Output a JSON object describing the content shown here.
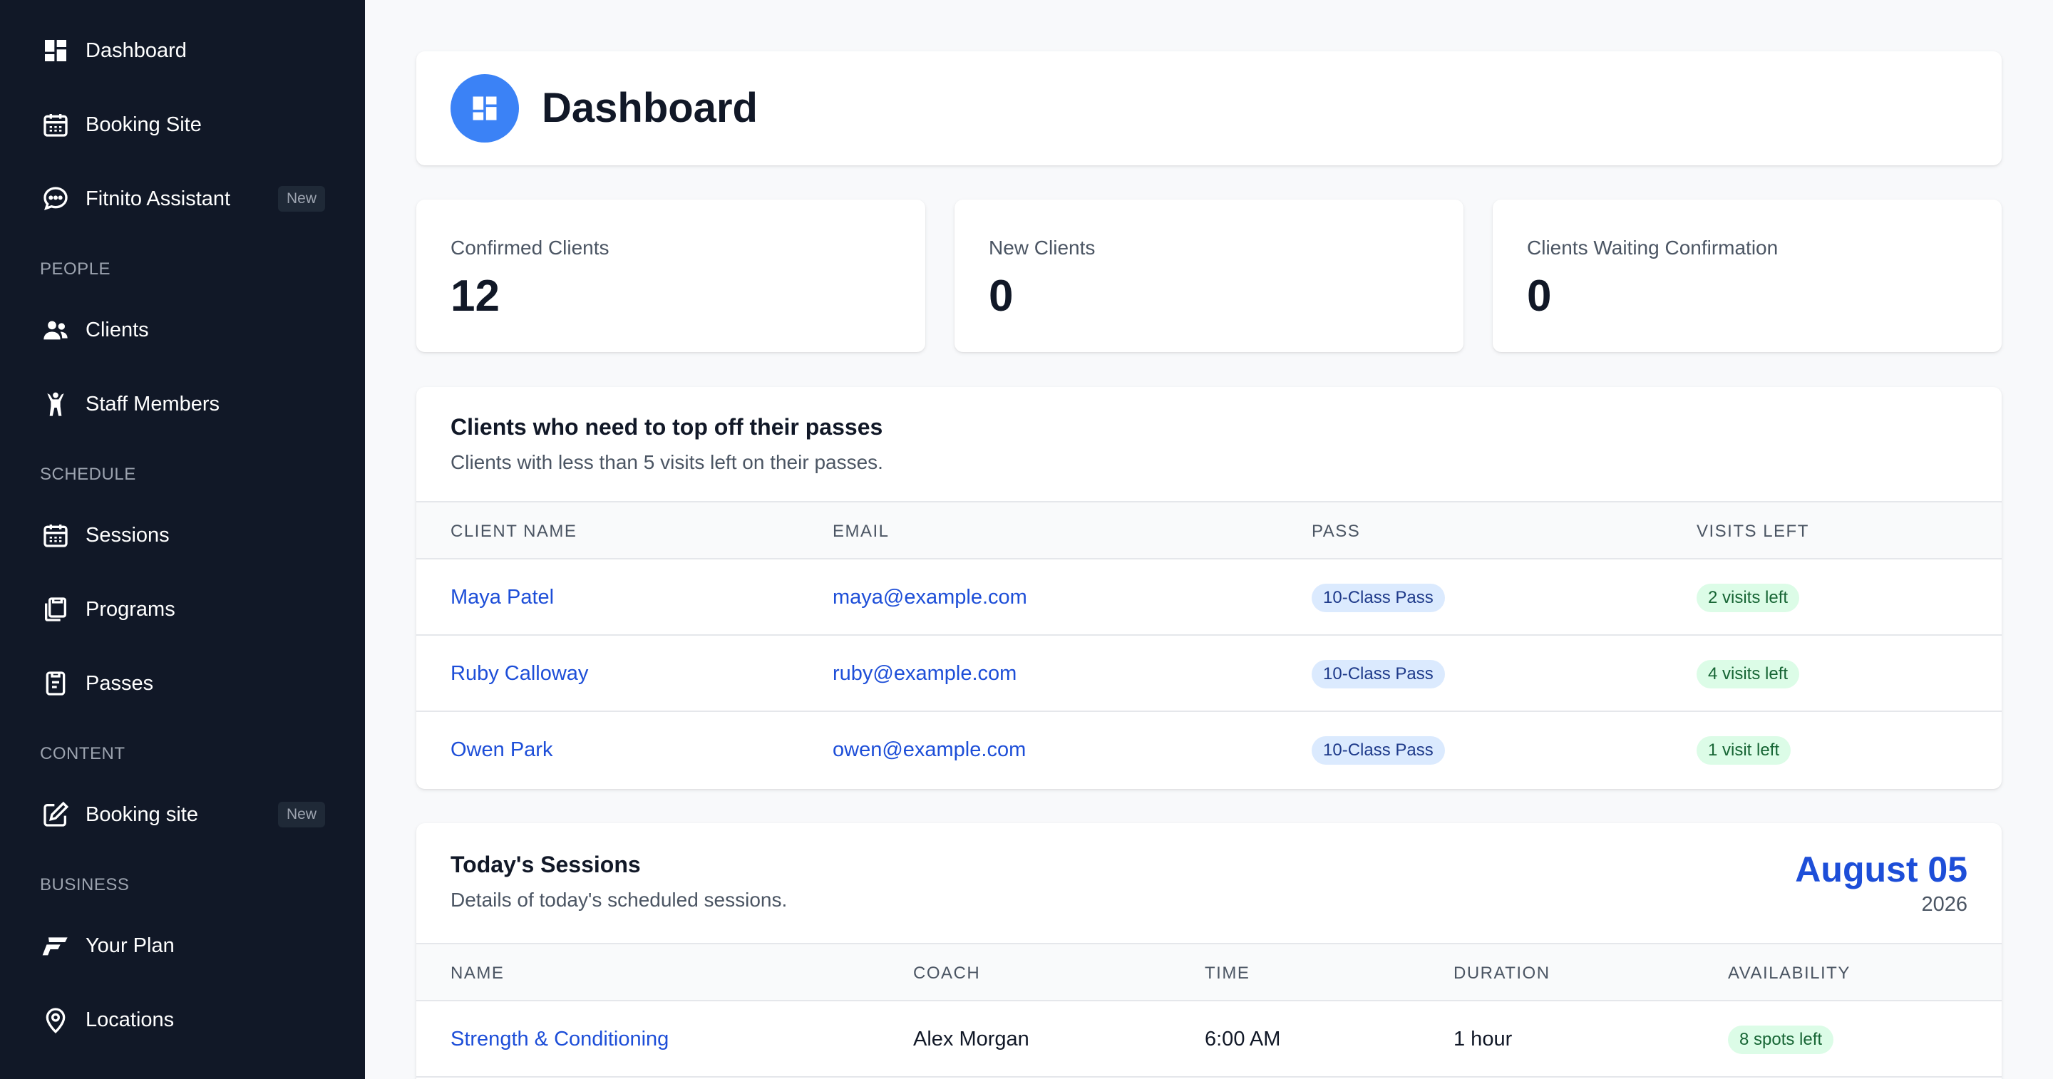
{
  "sidebar": {
    "items_top": [
      {
        "label": "Dashboard",
        "icon": "dashboard-icon"
      },
      {
        "label": "Booking Site",
        "icon": "calendar-icon"
      },
      {
        "label": "Fitnito Assistant",
        "icon": "chat-icon",
        "badge": "New"
      }
    ],
    "sections": {
      "people": "PEOPLE",
      "schedule": "SCHEDULE",
      "content": "CONTENT",
      "business": "BUSINESS"
    },
    "people_items": [
      {
        "label": "Clients",
        "icon": "users-icon"
      },
      {
        "label": "Staff Members",
        "icon": "person-icon"
      }
    ],
    "schedule_items": [
      {
        "label": "Sessions",
        "icon": "calendar-icon"
      },
      {
        "label": "Programs",
        "icon": "clipboard-icon"
      },
      {
        "label": "Passes",
        "icon": "pass-icon"
      }
    ],
    "content_items": [
      {
        "label": "Booking site",
        "icon": "edit-icon",
        "badge": "New"
      }
    ],
    "business_items": [
      {
        "label": "Your Plan",
        "icon": "plan-logo-icon"
      },
      {
        "label": "Locations",
        "icon": "map-pin-icon"
      }
    ]
  },
  "header": {
    "title": "Dashboard"
  },
  "stats": [
    {
      "label": "Confirmed Clients",
      "value": "12"
    },
    {
      "label": "New Clients",
      "value": "0"
    },
    {
      "label": "Clients Waiting Confirmation",
      "value": "0"
    }
  ],
  "topoff": {
    "title": "Clients who need to top off their passes",
    "subtitle": "Clients with less than 5 visits left on their passes.",
    "columns": [
      "CLIENT NAME",
      "EMAIL",
      "PASS",
      "VISITS LEFT"
    ],
    "rows": [
      {
        "name": "Maya Patel",
        "email": "maya@example.com",
        "pass": "10-Class Pass",
        "visits": "2 visits left"
      },
      {
        "name": "Ruby Calloway",
        "email": "ruby@example.com",
        "pass": "10-Class Pass",
        "visits": "4 visits left"
      },
      {
        "name": "Owen Park",
        "email": "owen@example.com",
        "pass": "10-Class Pass",
        "visits": "1 visit left"
      }
    ]
  },
  "sessions": {
    "title": "Today's Sessions",
    "subtitle": "Details of today's scheduled sessions.",
    "date": "August 05",
    "year": "2026",
    "columns": [
      "NAME",
      "COACH",
      "TIME",
      "DURATION",
      "AVAILABILITY"
    ],
    "rows": [
      {
        "name": "Strength & Conditioning",
        "coach": "Alex Morgan",
        "time": "6:00 AM",
        "duration": "1 hour",
        "availability": "8 spots left"
      }
    ]
  },
  "colors": {
    "sidebar_bg": "#111827",
    "accent": "#3b82f6",
    "link": "#1d4ed8"
  }
}
